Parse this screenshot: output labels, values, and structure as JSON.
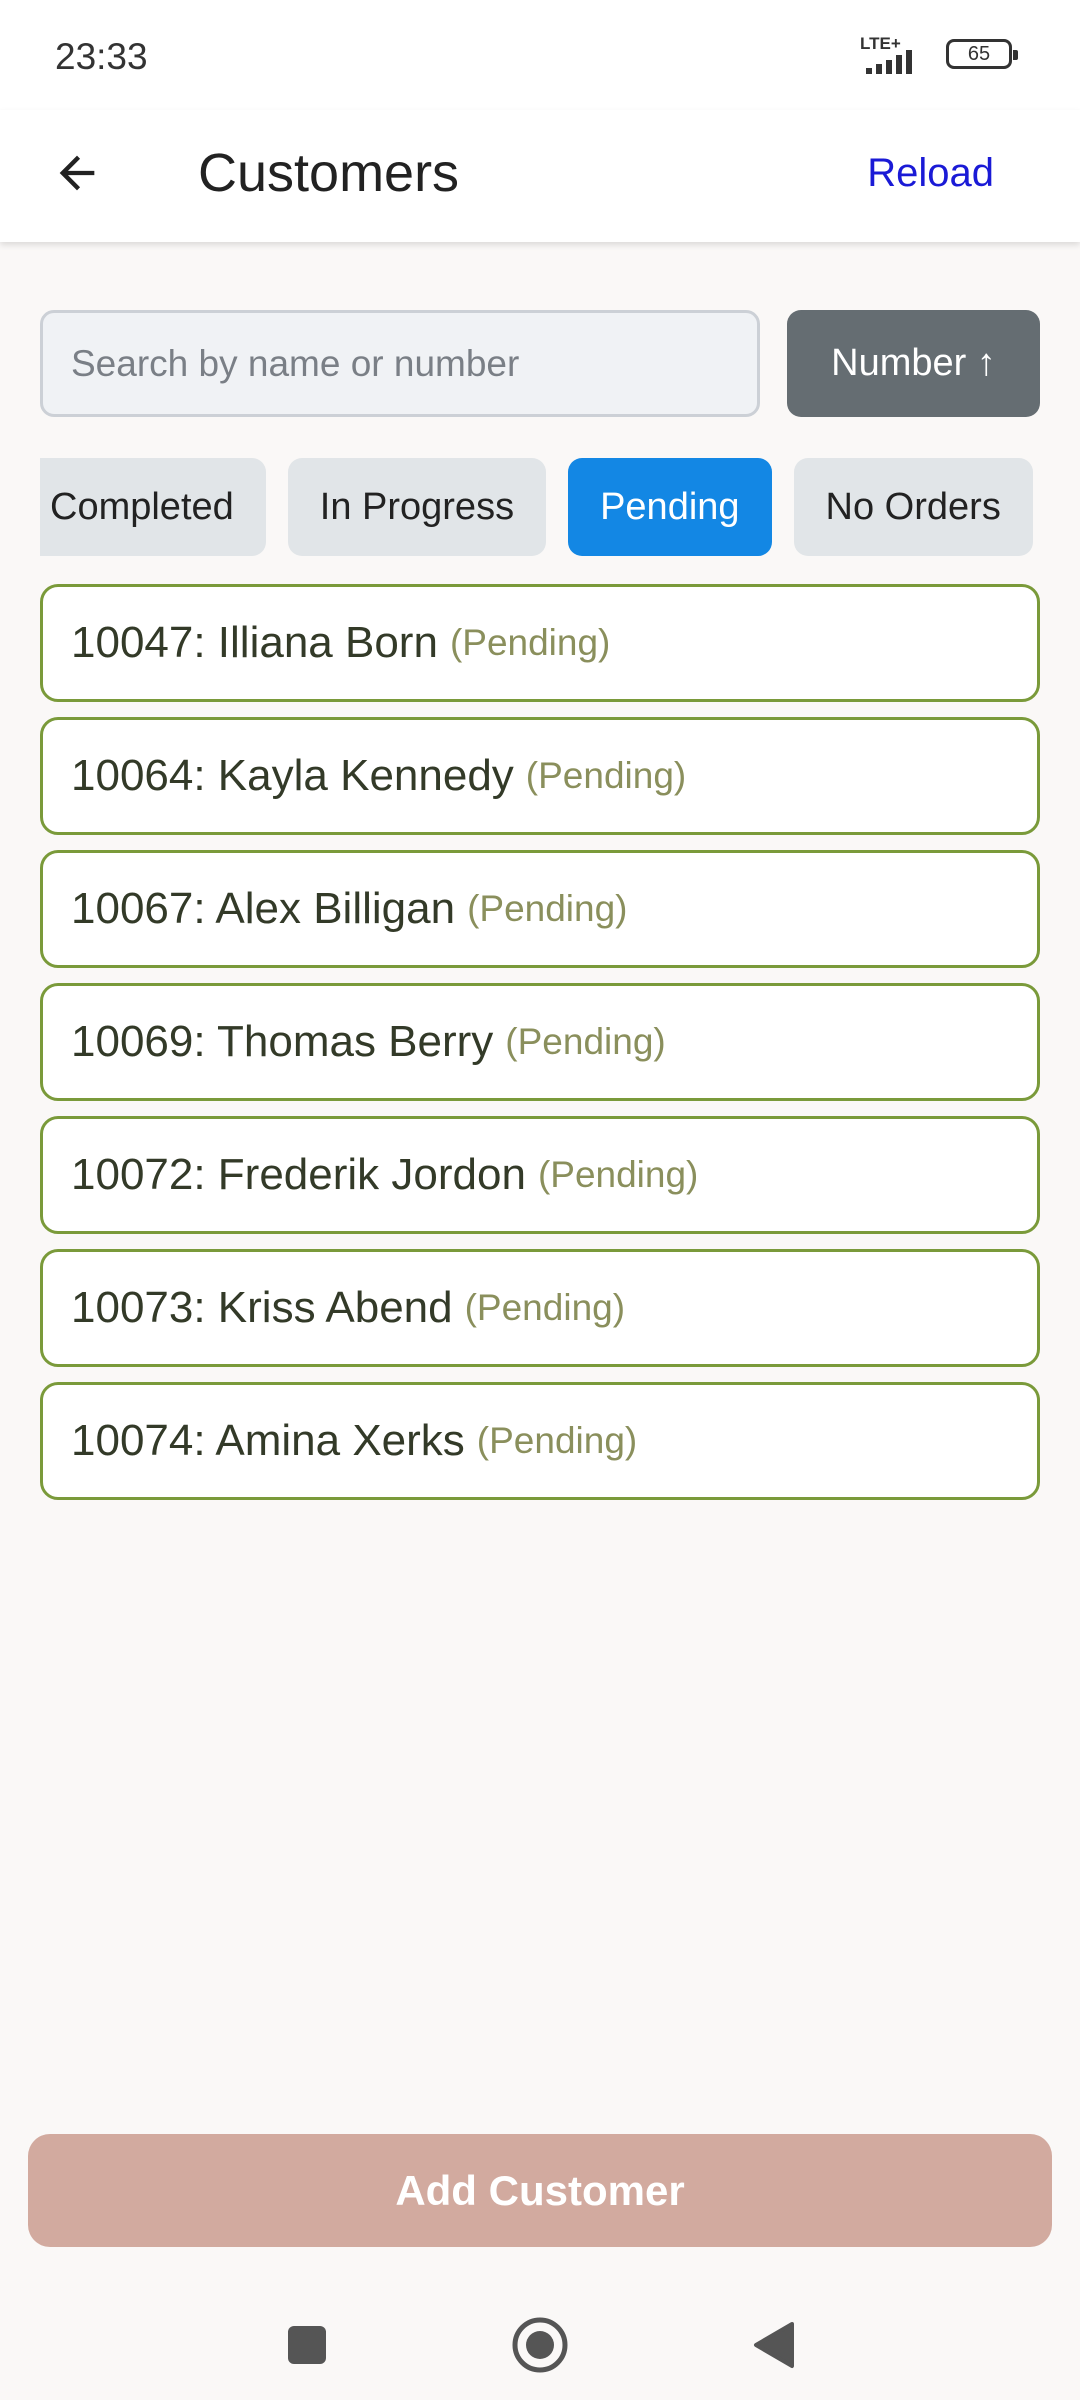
{
  "status_bar": {
    "time": "23:33",
    "network": "LTE+",
    "battery": "65"
  },
  "header": {
    "title": "Customers",
    "reload_label": "Reload",
    "back_icon": "arrow-left-icon"
  },
  "search": {
    "placeholder": "Search by name or number",
    "value": ""
  },
  "sort": {
    "label": "Number ↑"
  },
  "filters": [
    {
      "label": "Completed",
      "active": false
    },
    {
      "label": "In Progress",
      "active": false
    },
    {
      "label": "Pending",
      "active": true
    },
    {
      "label": "No Orders",
      "active": false
    }
  ],
  "customers": [
    {
      "label": "10047: Illiana Born",
      "status": "(Pending)"
    },
    {
      "label": "10064: Kayla Kennedy",
      "status": "(Pending)"
    },
    {
      "label": "10067: Alex Billigan",
      "status": "(Pending)"
    },
    {
      "label": "10069: Thomas Berry",
      "status": "(Pending)"
    },
    {
      "label": "10072: Frederik Jordon",
      "status": "(Pending)"
    },
    {
      "label": "10073: Kriss Abend",
      "status": "(Pending)"
    },
    {
      "label": "10074: Amina Xerks",
      "status": "(Pending)"
    }
  ],
  "footer": {
    "add_label": "Add Customer"
  },
  "colors": {
    "accent": "#1387e4",
    "item_border": "#7a9a3a",
    "add_button": "#d2aa9f",
    "reload": "#1a1ad6"
  },
  "nav": {
    "recents_icon": "square-icon",
    "home_icon": "circle-home-icon",
    "back_icon": "triangle-back-icon"
  }
}
